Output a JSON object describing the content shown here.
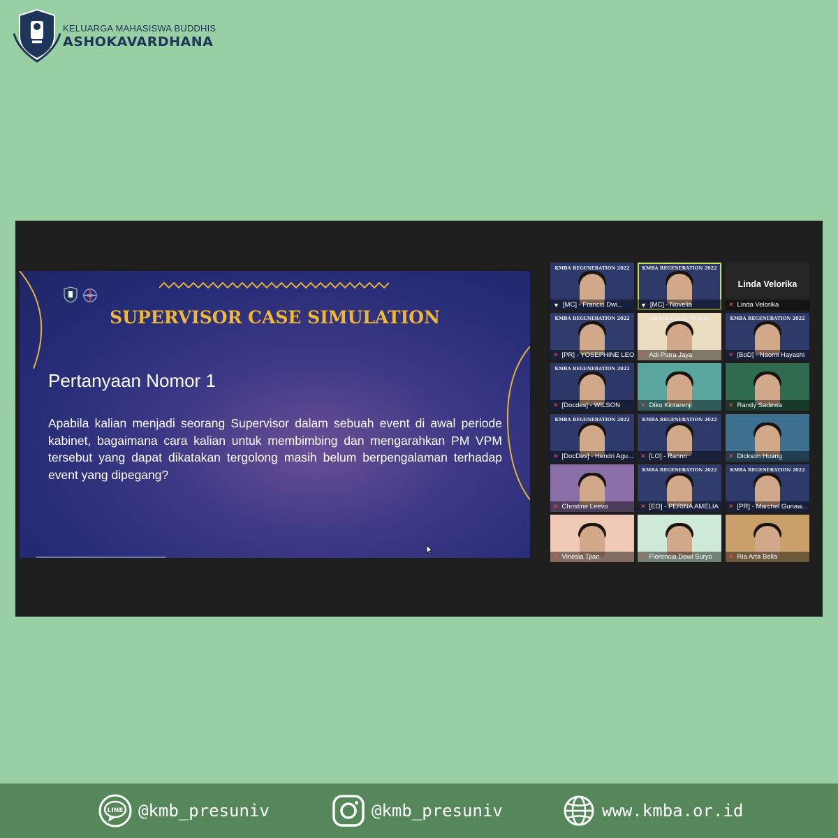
{
  "header": {
    "org_line1": "KELUARGA MAHASISWA BUDDHIS",
    "org_line2": "ASHOKAVARDHANA"
  },
  "slide": {
    "title": "SUPERVISOR CASE SIMULATION",
    "question_heading": "Pertanyaan Nomor 1",
    "question_body": "Apabila kalian menjadi seorang Supervisor dalam sebuah event di awal periode kabinet, bagaimana  cara kalian untuk membimbing dan mengarahkan PM VPM tersebut yang  dapat dikatakan tergolong masih belum berpengalaman terhadap event yang dipegang?"
  },
  "participants": [
    {
      "name": "[MC] - Francis Dwi...",
      "banner": "KMBA REGENERATION 2022",
      "mic": "pin"
    },
    {
      "name": "[MC] - Novelia",
      "banner": "KMBA REGENERATION 2022",
      "mic": "pin",
      "active": true
    },
    {
      "name": "Linda Velorika",
      "display": "Linda Velorika",
      "mic": "muted"
    },
    {
      "name": "[PR] - YOSEPHINE LEO...",
      "banner": "KMBA REGENERATION 2022",
      "mic": "muted"
    },
    {
      "name": "Adi Putra Jaya",
      "banner": "Adi Putra Jaya | IT 2020",
      "mic": "muted"
    },
    {
      "name": "[BoD] - Naomi Hayashi",
      "banner": "KMBA REGENERATION 2022",
      "mic": "muted"
    },
    {
      "name": "[Docdes] - WILSON",
      "banner": "KMBA REGENERATION 2022",
      "mic": "muted"
    },
    {
      "name": "Diko Kintarenji",
      "banner": "",
      "mic": "muted"
    },
    {
      "name": "Randy Sadewa",
      "banner": "",
      "mic": "muted"
    },
    {
      "name": "[DocDes] - Hendri Agu...",
      "banner": "KMBA REGENERATION 2022",
      "mic": "muted"
    },
    {
      "name": "[LO] - Rannn",
      "banner": "KMBA REGENERATION 2022",
      "mic": "muted"
    },
    {
      "name": "Dickson Huang",
      "banner": "",
      "mic": "muted"
    },
    {
      "name": "Christine Leevo",
      "banner": "",
      "mic": "muted"
    },
    {
      "name": "[EO] - PERINA AMELIA",
      "banner": "KMBA REGENERATION 2022",
      "mic": "muted"
    },
    {
      "name": "[PR] - Marchel Gunaw...",
      "banner": "KMBA REGENERATION 2022",
      "mic": "muted"
    },
    {
      "name": "Vinesia Tjian",
      "banner": "",
      "mic": "muted"
    },
    {
      "name": "Fiorencia Dewi Suryo",
      "banner": "",
      "mic": "muted"
    },
    {
      "name": "Ria Arta Bella",
      "banner": "",
      "mic": "muted"
    }
  ],
  "footer": {
    "line": "@kmb_presuniv",
    "instagram": "@kmb_presuniv",
    "website": "www.kmba.or.id"
  },
  "colors": {
    "background": "#98d0a4",
    "footer": "#55875a",
    "slide_title": "#f1b933"
  }
}
